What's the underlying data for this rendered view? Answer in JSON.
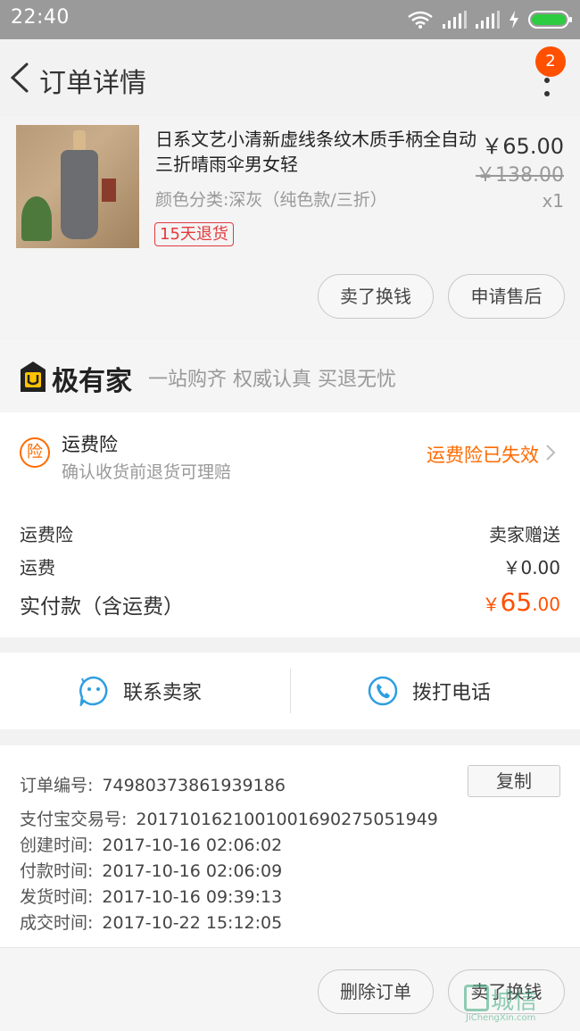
{
  "status_bar": {
    "time": "22:40"
  },
  "header": {
    "title": "订单详情",
    "badge_count": "2"
  },
  "product": {
    "name": "日系文艺小清新虚线条纹木质手柄全自动三折晴雨伞男女轻",
    "spec": "颜色分类:深灰（纯色款/三折）",
    "return_badge": "15天退货",
    "price": "￥65.00",
    "original_price": "￥138.00",
    "quantity": "x1",
    "sell_button": "卖了换钱",
    "after_sale_button": "申请售后"
  },
  "brand": {
    "name": "极有家",
    "slogan": "一站购齐 权威认真 买退无忧"
  },
  "insurance": {
    "icon_text": "险",
    "title": "运费险",
    "desc": "确认收货前退货可理赔",
    "status": "运费险已失效"
  },
  "costs": {
    "insurance_label": "运费险",
    "insurance_value": "卖家赠送",
    "shipping_label": "运费",
    "shipping_value": "￥0.00",
    "paid_label": "实付款（含运费）",
    "paid_currency": "￥",
    "paid_int": "65",
    "paid_dec": ".00"
  },
  "contact": {
    "seller_label": "联系卖家",
    "phone_label": "拨打电话"
  },
  "order_info": {
    "order_no_label": "订单编号:",
    "order_no": "74980373861939186",
    "copy_button": "复制",
    "alipay_label": "支付宝交易号:",
    "alipay_no": "2017101621001001690275051949",
    "created_label": "创建时间:",
    "created_time": "2017-10-16 02:06:02",
    "paid_label": "付款时间:",
    "paid_time": "2017-10-16 02:06:09",
    "shipped_label": "发货时间:",
    "shipped_time": "2017-10-16 09:39:13",
    "done_label": "成交时间:",
    "done_time": "2017-10-22 15:12:05"
  },
  "footer": {
    "delete_button": "删除订单",
    "sell_button": "卖了换钱"
  },
  "watermark": {
    "cn": "城信",
    "en": "JiChengXin.com"
  },
  "colors": {
    "accent": "#ff5000",
    "insurance_orange": "#ff6a00",
    "return_red": "#e4393c",
    "contact_blue": "#2f9ee0"
  }
}
